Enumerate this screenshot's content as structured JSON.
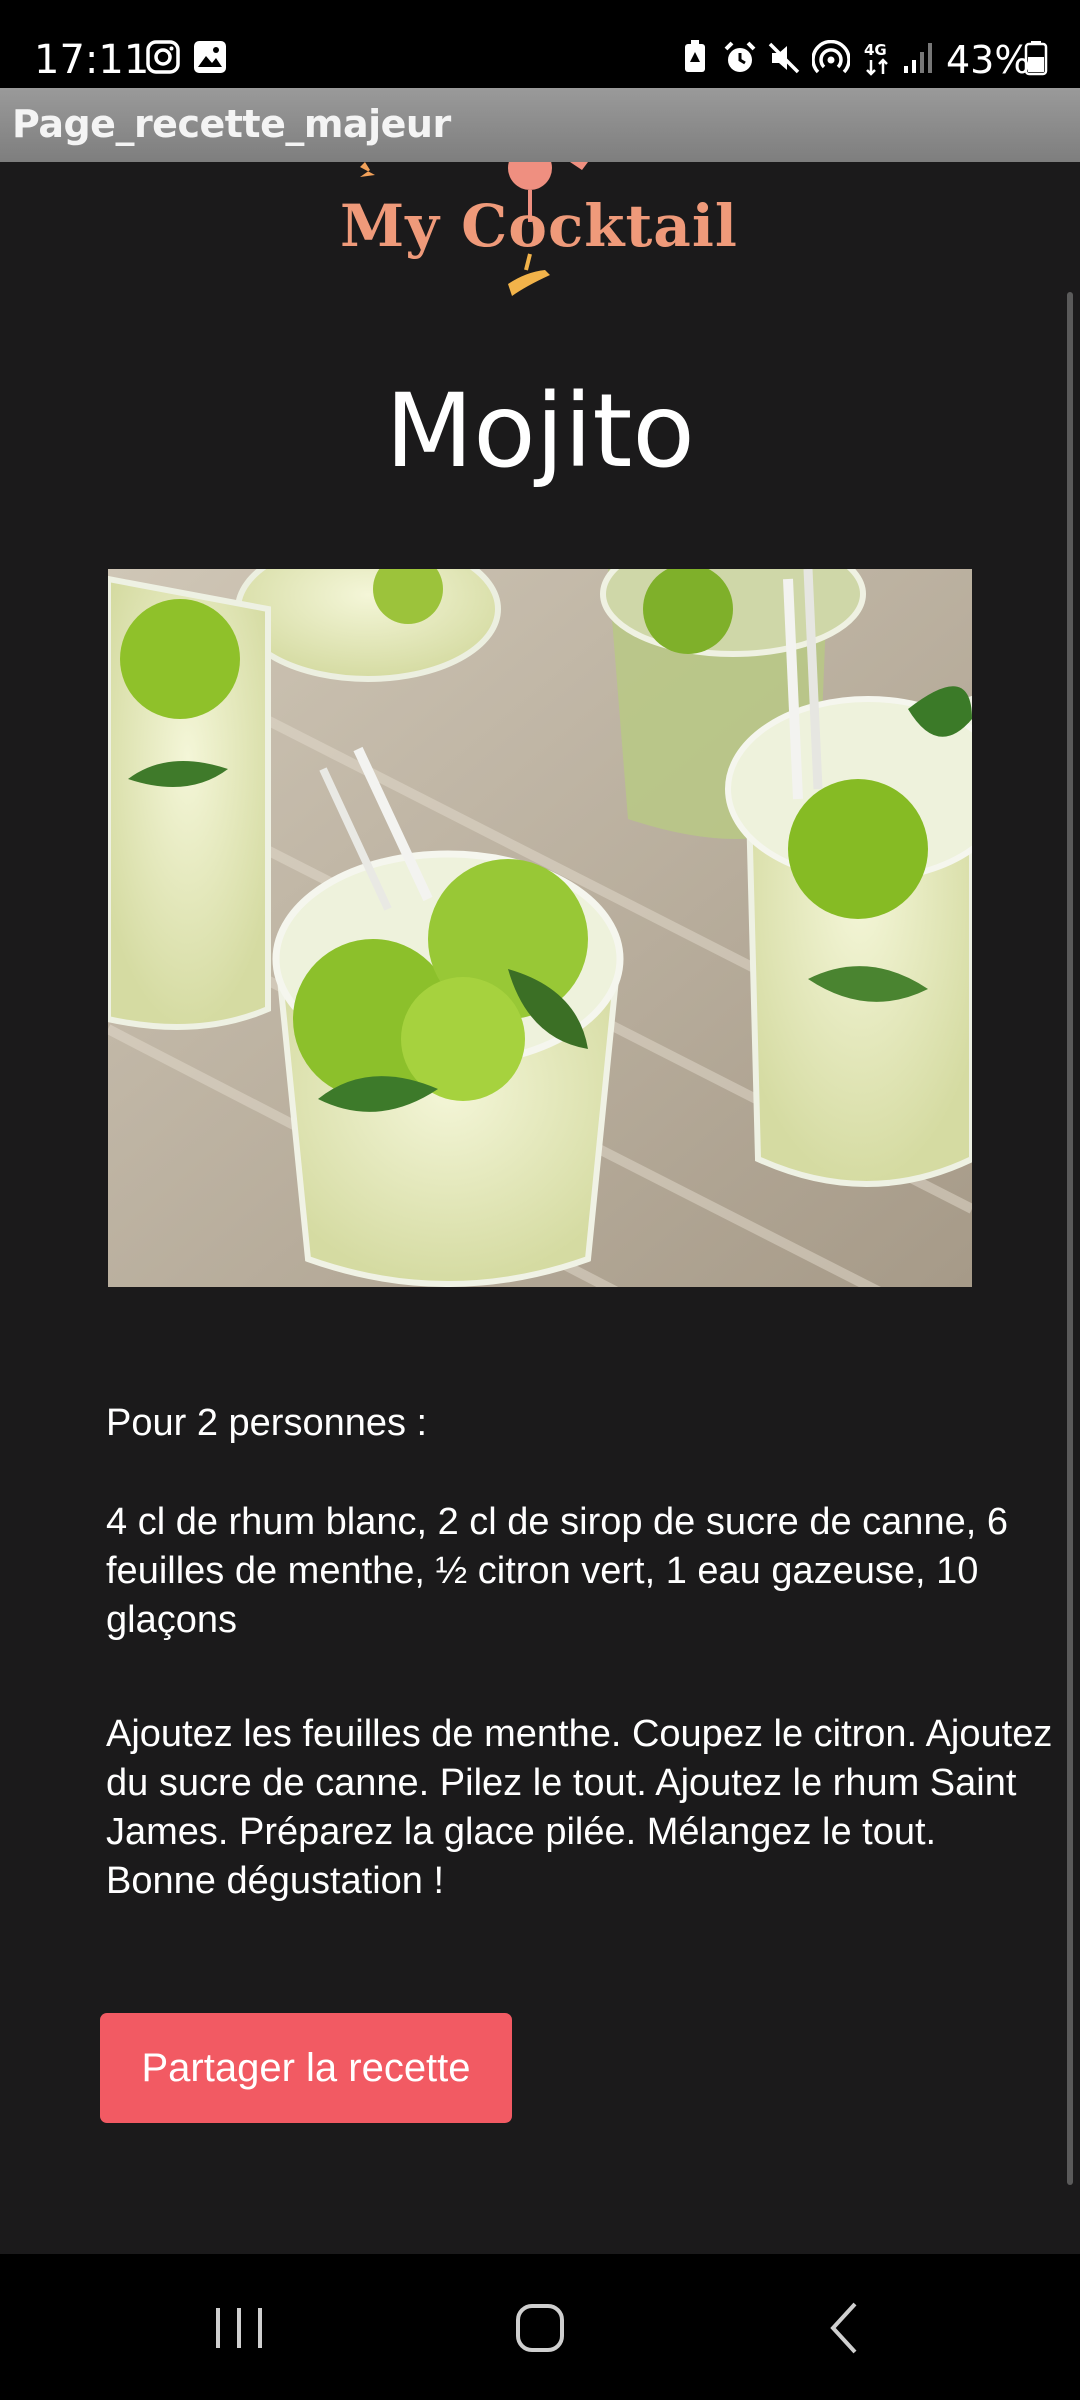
{
  "status_bar": {
    "time": "17:11",
    "battery": "43%",
    "network": "4G"
  },
  "app_bar": {
    "title": "Page_recette_majeur"
  },
  "logo": {
    "text": "My Cocktail",
    "color": "#ef9a7a"
  },
  "recipe": {
    "title": "Mojito",
    "servings": "Pour 2 personnes :",
    "ingredients": "4 cl de rhum blanc, 2 cl de sirop de sucre de canne, 6 feuilles de menthe, ½ citron vert, 1 eau gazeuse, 10 glaçons",
    "instructions": "Ajoutez les feuilles de menthe. Coupez le citron. Ajoutez du sucre de canne. Pilez le tout. Ajoutez le rhum Saint James. Préparez la glace pilée. Mélangez le tout. Bonne dégustation !"
  },
  "share_button": {
    "label": "Partager la recette",
    "color": "#f25a63"
  },
  "nav_bar": {
    "recents_icon": "recents-icon",
    "home_icon": "home-icon",
    "back_icon": "back-icon"
  }
}
